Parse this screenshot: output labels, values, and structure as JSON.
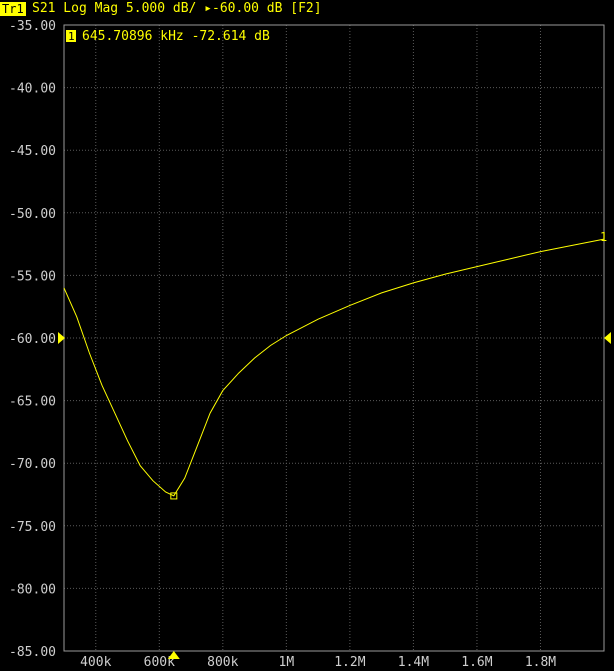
{
  "header": {
    "trace_tag": "Tr1",
    "trace_text": "S21 Log Mag 5.000 dB/ ▸-60.00 dB [F2]"
  },
  "marker": {
    "number": "1",
    "readout": "645.70896 kHz -72.614 dB",
    "color": "#ffff00"
  },
  "chart_data": {
    "type": "line",
    "ylim": [
      -85,
      -35
    ],
    "xlim_khz": [
      300,
      2000
    ],
    "y_ticks": [
      -35,
      -40,
      -45,
      -50,
      -55,
      -60,
      -65,
      -70,
      -75,
      -80,
      -85
    ],
    "y_tick_labels": [
      "-35.00",
      "-40.00",
      "-45.00",
      "-50.00",
      "-55.00",
      "-60.00",
      "-65.00",
      "-70.00",
      "-75.00",
      "-80.00",
      "-85.00"
    ],
    "x_ticks_khz": [
      400,
      600,
      800,
      1000,
      1200,
      1400,
      1600,
      1800
    ],
    "x_tick_labels": [
      "400k",
      "600k",
      "800k",
      "1M",
      "1.2M",
      "1.4M",
      "1.6M",
      "1.8M"
    ],
    "reference_level_db": -60,
    "series": [
      {
        "color": "#ffff00",
        "x_khz": [
          300,
          340,
          380,
          420,
          460,
          500,
          540,
          580,
          620,
          645.7,
          680,
          720,
          760,
          800,
          850,
          900,
          950,
          1000,
          1100,
          1200,
          1300,
          1400,
          1500,
          1600,
          1700,
          1800,
          1900,
          2000
        ],
        "y_db": [
          -56.0,
          -58.3,
          -61.2,
          -63.8,
          -66.0,
          -68.2,
          -70.2,
          -71.4,
          -72.3,
          -72.6,
          -71.2,
          -68.6,
          -66.0,
          -64.2,
          -62.8,
          -61.6,
          -60.6,
          -59.8,
          -58.5,
          -57.4,
          -56.4,
          -55.6,
          -54.9,
          -54.3,
          -53.7,
          -53.1,
          -52.6,
          -52.1
        ]
      }
    ]
  }
}
